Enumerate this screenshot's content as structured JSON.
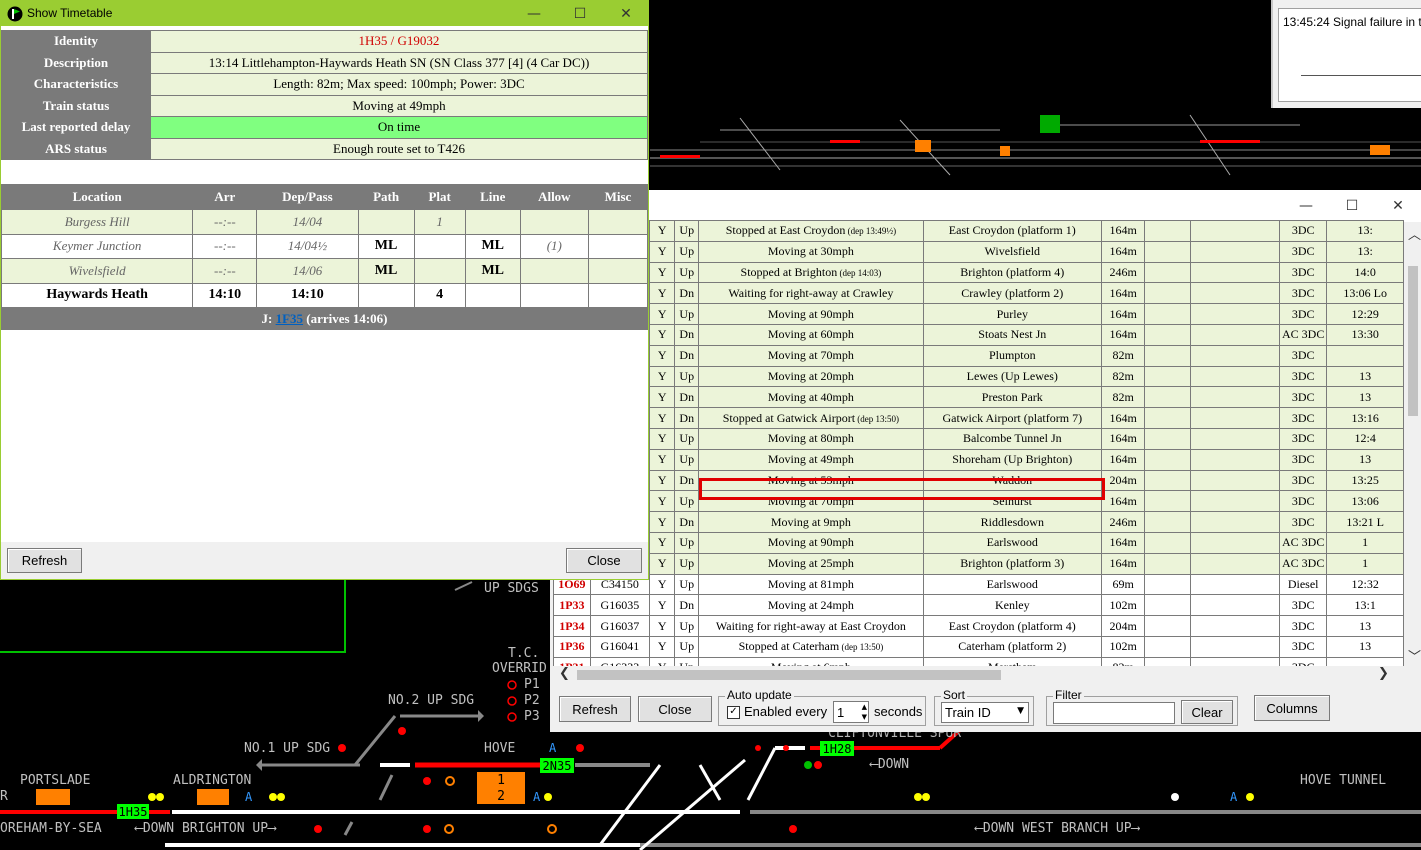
{
  "timetable_window": {
    "title": "Show Timetable",
    "controls": {
      "minimize": "—",
      "maximize": "☐",
      "close": "✕"
    },
    "details": [
      {
        "label": "Identity",
        "value": "1H35 / G19032"
      },
      {
        "label": "Description",
        "value": "13:14 Littlehampton-Haywards Heath SN (SN Class 377 [4] (4 Car DC))"
      },
      {
        "label": "Characteristics",
        "value": "Length: 82m; Max speed: 100mph; Power: 3DC"
      },
      {
        "label": "Train status",
        "value": "Moving at 49mph"
      },
      {
        "label": "Last reported delay",
        "value": "On time"
      },
      {
        "label": "ARS status",
        "value": "Enough route set to T426"
      }
    ],
    "columns": [
      "Location",
      "Arr",
      "Dep/Pass",
      "Path",
      "Plat",
      "Line",
      "Allow",
      "Misc"
    ],
    "stops": [
      {
        "location": "Burgess Hill",
        "arr": "--:--",
        "dep": "14/04",
        "path": "",
        "plat": "1",
        "line": "",
        "allow": "",
        "misc": ""
      },
      {
        "location": "Keymer Junction",
        "arr": "--:--",
        "dep": "14/04½",
        "path": "ML",
        "plat": "",
        "line": "ML",
        "allow": "(1)",
        "misc": ""
      },
      {
        "location": "Wivelsfield",
        "arr": "--:--",
        "dep": "14/06",
        "path": "ML",
        "plat": "",
        "line": "ML",
        "allow": "",
        "misc": ""
      },
      {
        "location": "Haywards Heath",
        "arr": "14:10",
        "dep": "14:10",
        "path": "",
        "plat": "4",
        "line": "",
        "allow": "",
        "misc": ""
      }
    ],
    "join": {
      "prefix": "J: ",
      "link": "1F35",
      "suffix": " (arrives 14:06)"
    },
    "refresh_label": "Refresh",
    "close_label": "Close"
  },
  "message_window": {
    "text": "13:45:24 Signal failure in t"
  },
  "train_list": {
    "controls": {
      "minimize": "—",
      "maximize": "☐",
      "close": "✕"
    },
    "rows": [
      {
        "id": "",
        "uid": "",
        "ars": "Y",
        "dir": "Up",
        "status": "Stopped at East Croydon",
        "status_note": " (dep 13:49½)",
        "loc": "East Croydon (platform 1)",
        "len": "164m",
        "power": "3DC",
        "time": "13:"
      },
      {
        "id": "",
        "uid": "",
        "ars": "Y",
        "dir": "Up",
        "status": "Moving at 30mph",
        "status_note": "",
        "loc": "Wivelsfield",
        "len": "164m",
        "power": "3DC",
        "time": "13:"
      },
      {
        "id": "",
        "uid": "",
        "ars": "Y",
        "dir": "Up",
        "status": "Stopped at Brighton",
        "status_note": " (dep 14:03)",
        "loc": "Brighton (platform 4)",
        "len": "246m",
        "power": "3DC",
        "time": "14:0"
      },
      {
        "id": "",
        "uid": "",
        "ars": "Y",
        "dir": "Dn",
        "status": "Waiting for right-away at Crawley",
        "status_note": "",
        "loc": "Crawley (platform 2)",
        "len": "164m",
        "power": "3DC",
        "time": "13:06 Lo"
      },
      {
        "id": "",
        "uid": "",
        "ars": "Y",
        "dir": "Up",
        "status": "Moving at 90mph",
        "status_note": "",
        "loc": "Purley",
        "len": "164m",
        "power": "3DC",
        "time": "12:29"
      },
      {
        "id": "",
        "uid": "",
        "ars": "Y",
        "dir": "Dn",
        "status": "Moving at 60mph",
        "status_note": "",
        "loc": "Stoats Nest Jn",
        "len": "164m",
        "power": "AC 3DC",
        "time": "13:30"
      },
      {
        "id": "",
        "uid": "",
        "ars": "Y",
        "dir": "Dn",
        "status": "Moving at 70mph",
        "status_note": "",
        "loc": "Plumpton",
        "len": "82m",
        "power": "3DC",
        "time": ""
      },
      {
        "id": "",
        "uid": "",
        "ars": "Y",
        "dir": "Up",
        "status": "Moving at 20mph",
        "status_note": "",
        "loc": "Lewes (Up Lewes)",
        "len": "82m",
        "power": "3DC",
        "time": "13"
      },
      {
        "id": "",
        "uid": "",
        "ars": "Y",
        "dir": "Dn",
        "status": "Moving at 40mph",
        "status_note": "",
        "loc": "Preston Park",
        "len": "82m",
        "power": "3DC",
        "time": "13"
      },
      {
        "id": "",
        "uid": "",
        "ars": "Y",
        "dir": "Dn",
        "status": "Stopped at Gatwick Airport",
        "status_note": " (dep 13:50)",
        "loc": "Gatwick Airport (platform 7)",
        "len": "164m",
        "power": "3DC",
        "time": "13:16"
      },
      {
        "id": "",
        "uid": "",
        "ars": "Y",
        "dir": "Up",
        "status": "Moving at 80mph",
        "status_note": "",
        "loc": "Balcombe Tunnel Jn",
        "len": "164m",
        "power": "3DC",
        "time": "12:4"
      },
      {
        "id": "",
        "uid": "",
        "ars": "Y",
        "dir": "Up",
        "status": "Moving at 49mph",
        "status_note": "",
        "loc": "Shoreham (Up Brighton)",
        "len": "164m",
        "power": "3DC",
        "time": "13"
      },
      {
        "id": "",
        "uid": "",
        "ars": "Y",
        "dir": "Dn",
        "status": "Moving at 53mph",
        "status_note": "",
        "loc": "Waddon",
        "len": "204m",
        "power": "3DC",
        "time": "13:25"
      },
      {
        "id": "",
        "uid": "",
        "ars": "Y",
        "dir": "Up",
        "status": "Moving at 70mph",
        "status_note": "",
        "loc": "Selhurst",
        "len": "164m",
        "power": "3DC",
        "time": "13:06"
      },
      {
        "id": "",
        "uid": "",
        "ars": "Y",
        "dir": "Dn",
        "status": "Moving at 9mph",
        "status_note": "",
        "loc": "Riddlesdown",
        "len": "246m",
        "power": "3DC",
        "time": "13:21 L"
      },
      {
        "id": "",
        "uid": "",
        "ars": "Y",
        "dir": "Up",
        "status": "Moving at 90mph",
        "status_note": "",
        "loc": "Earlswood",
        "len": "164m",
        "power": "AC 3DC",
        "time": "1"
      },
      {
        "id": "",
        "uid": "",
        "ars": "Y",
        "dir": "Up",
        "status": "Moving at 25mph",
        "status_note": "",
        "loc": "Brighton (platform 3)",
        "len": "164m",
        "power": "AC 3DC",
        "time": "1"
      },
      {
        "id": "1O69",
        "uid": "C34150",
        "ars": "Y",
        "dir": "Up",
        "status": "Moving at 81mph",
        "status_note": "",
        "loc": "Earlswood",
        "len": "69m",
        "power": "Diesel",
        "time": "12:32"
      },
      {
        "id": "1P33",
        "uid": "G16035",
        "ars": "Y",
        "dir": "Dn",
        "status": "Moving at 24mph",
        "status_note": "",
        "loc": "Kenley",
        "len": "102m",
        "power": "3DC",
        "time": "13:1"
      },
      {
        "id": "1P34",
        "uid": "G16037",
        "ars": "Y",
        "dir": "Up",
        "status": "Waiting for right-away at East Croydon",
        "status_note": "",
        "loc": "East Croydon (platform 4)",
        "len": "204m",
        "power": "3DC",
        "time": "13"
      },
      {
        "id": "1P36",
        "uid": "G16041",
        "ars": "Y",
        "dir": "Up",
        "status": "Stopped at Caterham",
        "status_note": " (dep 13:50)",
        "loc": "Caterham (platform 2)",
        "len": "102m",
        "power": "3DC",
        "time": "13"
      },
      {
        "id": "1P31",
        "uid": "G16333",
        "ars": "Y",
        "dir": "Up",
        "status": "Moving at 6mph",
        "status_note": "",
        "loc": "Merstham",
        "len": "82m",
        "power": "3DC",
        "time": ""
      }
    ],
    "refresh_label": "Refresh",
    "close_label": "Close",
    "auto_update": {
      "legend": "Auto update",
      "checkbox_label": "Enabled every",
      "checked": true,
      "value": "1",
      "unit": "seconds"
    },
    "sort": {
      "legend": "Sort",
      "value": "Train ID"
    },
    "filter": {
      "legend": "Filter",
      "value": "",
      "clear_label": "Clear"
    },
    "columns_label": "Columns"
  },
  "panel": {
    "labels": {
      "up_sdgs": "UP SDGS",
      "tc_override_1": "T.C.",
      "tc_override_2": "OVERRID",
      "p1": "P1",
      "p2": "P2",
      "p3": "P3",
      "no2_up_sdg": "NO.2 UP SDG",
      "no1_up_sdg": "NO.1 UP SDG",
      "hove": "HOVE",
      "cliftonville": "CLIFTONVILLE SPUR",
      "down_arrow": "⟵DOWN",
      "portslade": "PORTSLADE",
      "aldrington": "ALDRINGTON",
      "hove_tunnel": "HOVE TUNNEL",
      "shoreham_by_sea": "OREHAM-BY-SEA",
      "down_brighton_up": "⟵DOWN BRIGHTON UP⟶",
      "down_west_branch_up": "⟵DOWN WEST BRANCH UP⟶",
      "r_edge": "R"
    },
    "berths": {
      "b1": "1H35",
      "b2": "2N35",
      "b3": "1H28"
    },
    "platform_numbers": {
      "p_top": "1",
      "p_bottom": "2"
    },
    "signal_tags": {
      "a1": "A",
      "a2": "A",
      "a3": "A",
      "a4": "A"
    },
    "colors": {
      "track_red": "#ff0000",
      "track_white": "#ffffff",
      "track_grey": "#808080",
      "berth_green": "#00ff00",
      "platform_orange": "#ff8000",
      "label_grey": "#c0c0c0"
    }
  }
}
